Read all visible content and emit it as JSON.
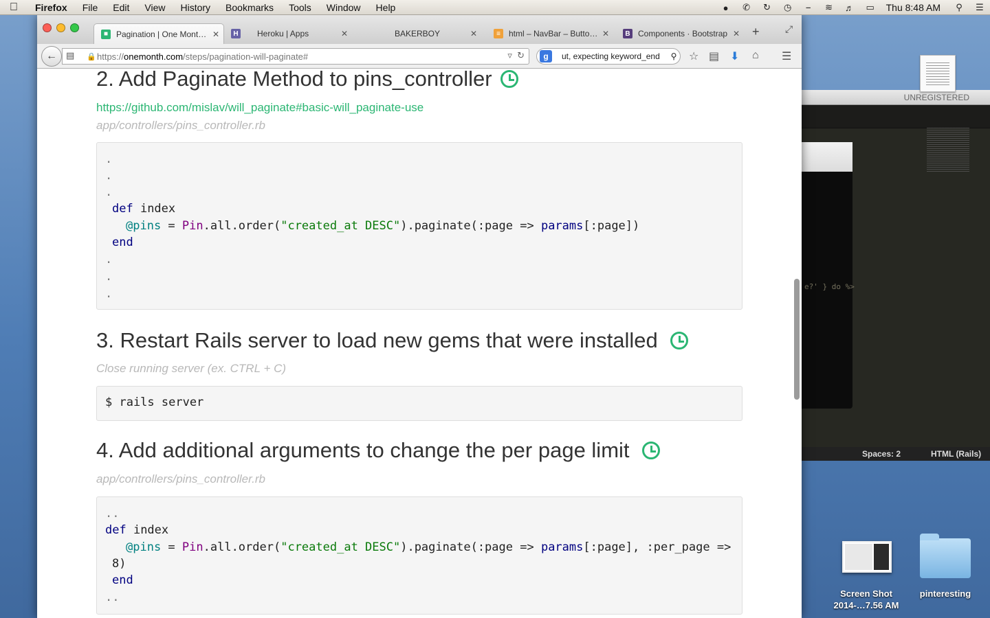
{
  "menubar": {
    "app": "Firefox",
    "items": [
      "File",
      "Edit",
      "View",
      "History",
      "Bookmarks",
      "Tools",
      "Window",
      "Help"
    ],
    "clock": "Thu 8:48 AM"
  },
  "tabs": [
    {
      "title": "Pagination | One Mont…",
      "active": true
    },
    {
      "title": "Heroku | Apps",
      "active": false
    },
    {
      "title": "BAKERBOY",
      "active": false
    },
    {
      "title": "html – NavBar – Butto…",
      "active": false
    },
    {
      "title": "Components · Bootstrap",
      "active": false
    }
  ],
  "urlbar": {
    "scheme": "https://",
    "host": "onemonth.com",
    "path": "/steps/pagination-will-paginate#"
  },
  "searchbar": {
    "engine_letter": "g",
    "query": "ut, expecting keyword_end"
  },
  "content": {
    "step2": {
      "heading": "2. Add Paginate Method to pins_controller",
      "link": "https://github.com/mislav/will_paginate#basic-will_paginate-use",
      "file": "app/controllers/pins_controller.rb",
      "code": {
        "dots_top": [
          ".",
          ".",
          "."
        ],
        "def": "def",
        "method": " index",
        "ivar": "@pins",
        "assign": " = ",
        "const": "Pin",
        "chain1": ".all.order(",
        "str": "\"created_at DESC\"",
        "chain2": ").paginate(",
        "sym": ":page",
        "arrow": " => ",
        "params": "params",
        "rest": "[:page])",
        "end": "end",
        "dots_bottom": [
          ".",
          ".",
          "."
        ]
      }
    },
    "step3": {
      "heading": "3. Restart Rails server to load new gems that were installed",
      "note": "Close running server (ex. CTRL + C)",
      "command": "$ rails server"
    },
    "step4": {
      "heading": "4. Add additional arguments to change the per page limit",
      "file": "app/controllers/pins_controller.rb",
      "code": {
        "dots_top": "..",
        "def": "def",
        "method": " index",
        "ivar": "@pins",
        "assign": " = ",
        "const": "Pin",
        "chain1": ".all.order(",
        "str": "\"created_at DESC\"",
        "chain2": ").paginate(",
        "sym": ":page",
        "arrow": " => ",
        "params": "params",
        "rest": "[:page], :per_page =>",
        "wrap": "8)",
        "end": "end",
        "dots_bottom": ".."
      }
    }
  },
  "background_editor": {
    "title": "UNREGISTERED",
    "status_spaces": "Spaces: 2",
    "status_syntax": "HTML (Rails)",
    "fragment": "e?' } do %>"
  },
  "desktop_icons": [
    {
      "label_line1": "Screen Shot",
      "label_line2": "2014-…7.56 AM"
    },
    {
      "label_line1": "pinteresting",
      "label_line2": ""
    }
  ]
}
